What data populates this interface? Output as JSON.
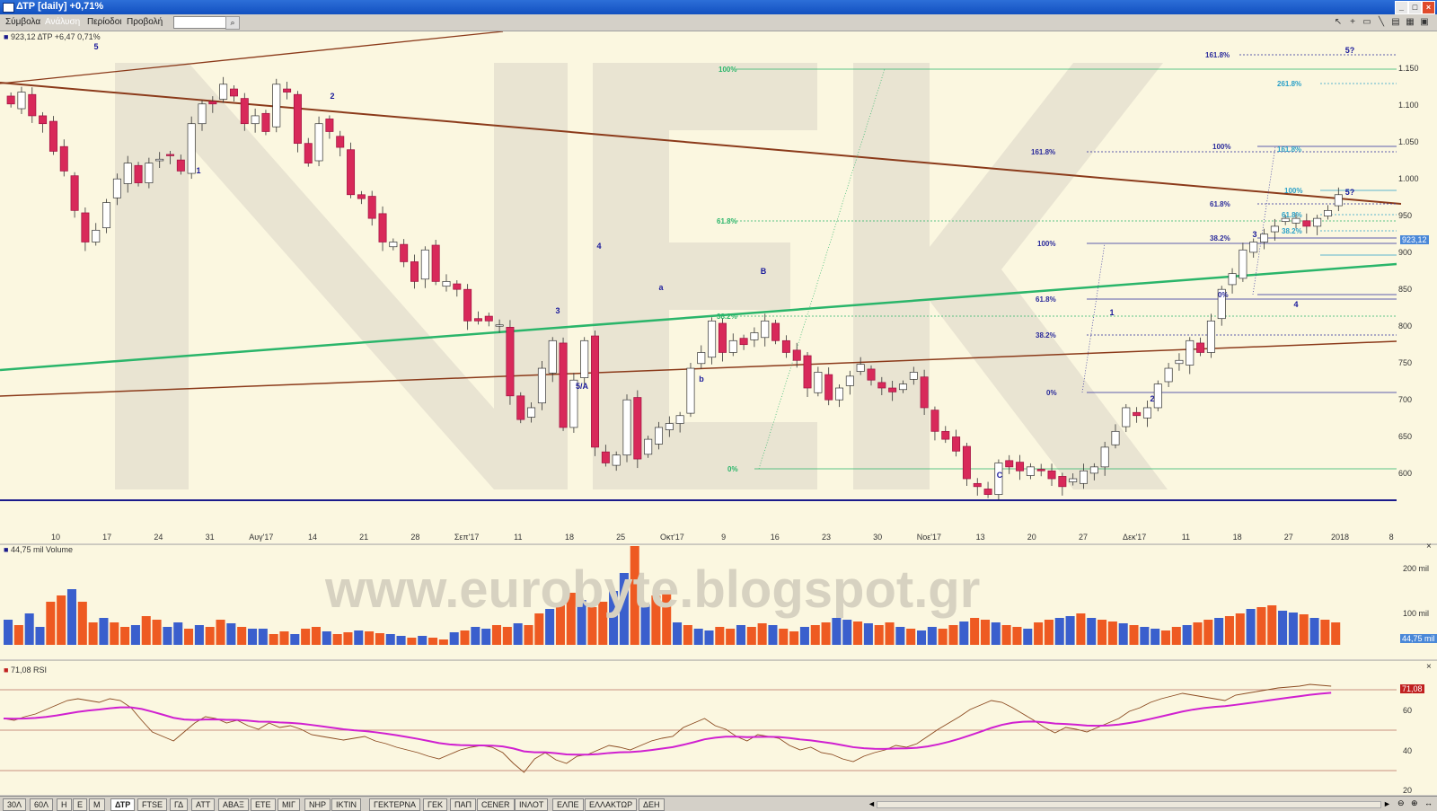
{
  "window": {
    "title": "ΔΤΡ [daily] +0,71%",
    "buttons": [
      "_",
      "□",
      "×"
    ]
  },
  "menu": {
    "items": [
      "Σύμβολα",
      "Ανάλυση",
      "Περίοδοι",
      "Προβολή"
    ],
    "search_value": ""
  },
  "tools": [
    "cursor-icon",
    "crosshair-icon",
    "rectangle-icon",
    "line-icon",
    "layout-icon",
    "grid-icon",
    "save-icon"
  ],
  "price_panel": {
    "legend": "923,12 ΔΤΡ +6,47 0,71%",
    "current_price": "923,12",
    "y_ticks": [
      "1.150",
      "1.100",
      "1.050",
      "1.000",
      "950",
      "900",
      "850",
      "800",
      "750",
      "700",
      "650",
      "600"
    ],
    "colors": {
      "up_candle": "#ffffff",
      "down_candle": "#d8295a",
      "green_trend": "#2ab56a",
      "brown_trend": "#8b3a1a"
    }
  },
  "watermark": {
    "logo": "NEK",
    "url": "www.eurobyte.blogspot.gr"
  },
  "wave_labels": [
    "5",
    "2",
    "1",
    "4",
    "3",
    "5/A",
    "a",
    "b",
    "B",
    "C",
    "1",
    "2",
    "3",
    "4",
    "5?",
    "5?"
  ],
  "fib_labels": [
    "100%",
    "61.8%",
    "0%",
    "38.2%",
    "100%",
    "61.8%",
    "38.2%",
    "0%",
    "161.8%",
    "100%",
    "61.8%",
    "38.2%",
    "0%",
    "161.8%",
    "261.8%",
    "161.8%",
    "100%",
    "61.8%",
    "38.2%"
  ],
  "x_ticks": [
    "10",
    "17",
    "24",
    "31",
    "Αυγ'17",
    "14",
    "21",
    "28",
    "Σεπ'17",
    "11",
    "18",
    "25",
    "Οκτ'17",
    "9",
    "16",
    "23",
    "30",
    "Νοε'17",
    "13",
    "20",
    "27",
    "Δεκ'17",
    "11",
    "18",
    "27",
    "2018",
    "8"
  ],
  "volume_panel": {
    "legend": "44,75 mil Volume",
    "y_ticks": [
      "200 mil",
      "100 mil"
    ],
    "current": "44,75 mil"
  },
  "rsi_panel": {
    "legend": "71,08 RSI",
    "y_ticks": [
      "60",
      "40",
      "20"
    ],
    "current": "71,08"
  },
  "tabs": {
    "left": [
      "30Λ",
      "60Λ",
      "Η",
      "Ε",
      "Μ"
    ],
    "symbols": [
      "ΔΤΡ",
      "FTSE",
      "ΓΔ",
      "ΑΤΤ",
      "ΑΒΑΞ",
      "ΕΤΕ",
      "ΜΙΓ",
      "ΝΗΡ",
      "ΙΚΤΙΝ",
      "ΓΕΚΤΕΡΝΑ",
      "ΓΕΚ",
      "ΠΑΠ",
      "CENER",
      "ΙΝΛΟΤ",
      "ΕΛΠΕ",
      "ΕΛΛΑΚΤΩΡ",
      "ΔΕΗ"
    ]
  }
}
